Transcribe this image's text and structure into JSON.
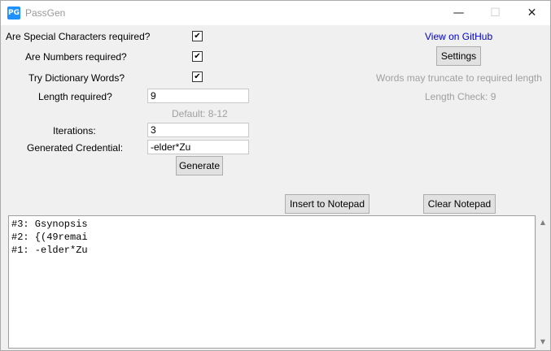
{
  "window": {
    "title": "PassGen",
    "icon_text": "PG",
    "minimize_glyph": "—",
    "maximize_glyph": "☐",
    "close_glyph": "✕"
  },
  "options": {
    "special_chars": {
      "label": "Are Special Characters required?",
      "checked": true
    },
    "numbers": {
      "label": "Are Numbers required?",
      "checked": true
    },
    "dictionary": {
      "label": "Try Dictionary Words?",
      "checked": true
    },
    "check_glyph": "✔"
  },
  "length": {
    "label": "Length required?",
    "value": "9",
    "default_hint": "Default: 8-12"
  },
  "iterations": {
    "label": "Iterations:",
    "value": "3"
  },
  "credential": {
    "label": "Generated Credential:",
    "value": "-elder*Zu"
  },
  "buttons": {
    "generate": "Generate",
    "settings": "Settings",
    "insert": "Insert to Notepad",
    "clear": "Clear Notepad"
  },
  "right_panel": {
    "github_link": "View on GitHub",
    "truncate_note": "Words may truncate to required length",
    "length_check": "Length Check: 9"
  },
  "notepad": {
    "lines": [
      "#3: Gsynopsis",
      "#2: {(49remai",
      "#1: -elder*Zu"
    ]
  },
  "scrollbar": {
    "up_glyph": "▲",
    "down_glyph": "▼"
  }
}
